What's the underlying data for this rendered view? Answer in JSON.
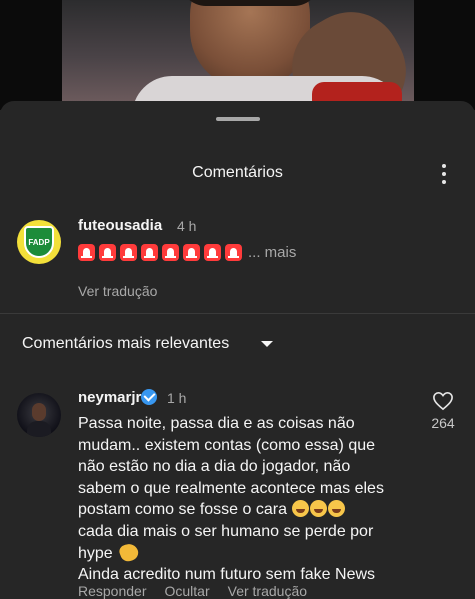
{
  "sheet": {
    "title": "Comentários"
  },
  "caption": {
    "username": "futeousadia",
    "time": "4 h",
    "emoji_name": "police-light-emoji",
    "emoji_count": 8,
    "more": "... mais",
    "translate": "Ver tradução"
  },
  "filter": {
    "label": "Comentários mais relevantes"
  },
  "comment": {
    "username": "neymarjr",
    "time": "1 h",
    "lines": [
      "Passa noite, passa dia e as coisas não",
      "mudam.. existem contas (como essa) que",
      "não estão no dia a dia do jogador, não",
      "sabem o que realmente acontece mas eles",
      "postam como se fosse o cara ",
      "cada dia mais o ser humano se perde por",
      "hype ",
      "Ainda acredito num futuro sem fake News"
    ],
    "like_count": "264",
    "actions": {
      "reply": "Responder",
      "hide": "Ocultar",
      "translate": "Ver tradução"
    }
  },
  "colors": {
    "background": "#262626",
    "text": "#f5f5f5",
    "muted": "#a8a8a8",
    "verified": "#3897f0",
    "siren": "#ff3b3b"
  }
}
